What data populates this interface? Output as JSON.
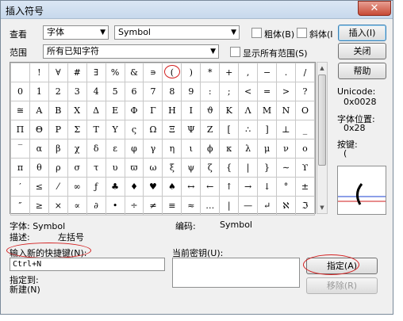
{
  "window": {
    "title": "插入符号",
    "close": "✕"
  },
  "controls": {
    "view_label": "查看",
    "view_combo": "字体",
    "font_combo": "Symbol",
    "bold_label": "粗体(B)",
    "italic_label": "斜体(I",
    "insert_button": "插入(I)",
    "range_label": "范围",
    "range_combo": "所有已知字符",
    "show_all_label": "显示所有范围(S)",
    "close_button": "关闭",
    "help_button": "帮助"
  },
  "grid": {
    "rows": [
      [
        "",
        "!",
        "∀",
        "#",
        "∃",
        "%",
        "&",
        "∍",
        "(",
        ")",
        "*",
        "+",
        ",",
        "−",
        ".",
        "/"
      ],
      [
        "0",
        "1",
        "2",
        "3",
        "4",
        "5",
        "6",
        "7",
        "8",
        "9",
        ":",
        ";",
        "<",
        "=",
        ">",
        "?"
      ],
      [
        "≅",
        "Α",
        "Β",
        "Χ",
        "Δ",
        "Ε",
        "Φ",
        "Γ",
        "Η",
        "Ι",
        "ϑ",
        "Κ",
        "Λ",
        "Μ",
        "Ν",
        "Ο"
      ],
      [
        "Π",
        "Θ",
        "Ρ",
        "Σ",
        "Τ",
        "Υ",
        "ς",
        "Ω",
        "Ξ",
        "Ψ",
        "Ζ",
        "[",
        "∴",
        "]",
        "⊥",
        "_"
      ],
      [
        "‾",
        "α",
        "β",
        "χ",
        "δ",
        "ε",
        "φ",
        "γ",
        "η",
        "ι",
        "ϕ",
        "κ",
        "λ",
        "μ",
        "ν",
        "ο"
      ],
      [
        "π",
        "θ",
        "ρ",
        "σ",
        "τ",
        "υ",
        "ϖ",
        "ω",
        "ξ",
        "ψ",
        "ζ",
        "{",
        "|",
        "}",
        "∼",
        "ϒ"
      ],
      [
        "′",
        "≤",
        "⁄",
        "∞",
        "ƒ",
        "♣",
        "♦",
        "♥",
        "♠",
        "↔",
        "←",
        "↑",
        "→",
        "↓",
        "°",
        "±"
      ],
      [
        "″",
        "≥",
        "×",
        "∝",
        "∂",
        "•",
        "÷",
        "≠",
        "≡",
        "≈",
        "…",
        "|",
        "—",
        "↵",
        "ℵ",
        "ℑ"
      ]
    ]
  },
  "info": {
    "unicode_label": "Unicode:",
    "unicode_value": "0x0028",
    "charpos_label": "字体位置:",
    "charpos_value": "0x28",
    "key_label": "按键:",
    "key_value": "("
  },
  "details": {
    "font_label": "字体: Symbol",
    "desc_label": "描述:",
    "desc_value": "左括号",
    "encoding_label": "编码:",
    "encoding_value": "Symbol"
  },
  "shortcut": {
    "new_key_label": "输入新的快捷键(N):",
    "new_key_value": "Ctrl+N",
    "current_keys_label": "当前密钥(U):",
    "assign_button": "指定(A)",
    "remove_button": "移除(R)",
    "assigned_to_label": "指定到:",
    "assigned_to_value": "新建(N)"
  }
}
